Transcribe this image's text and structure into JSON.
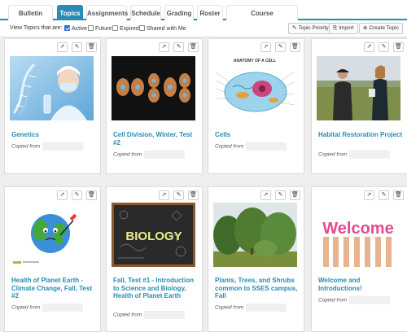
{
  "tabs": [
    {
      "label": "Bulletin board",
      "active": false
    },
    {
      "label": "Topics",
      "active": true
    },
    {
      "label": "Assignments",
      "active": false
    },
    {
      "label": "Schedule",
      "active": false
    },
    {
      "label": "Grading",
      "active": false
    },
    {
      "label": "Roster",
      "active": false
    },
    {
      "label": "Course recommendations",
      "active": false
    }
  ],
  "filter": {
    "label": "View Topics that are:",
    "options": [
      {
        "label": "Active",
        "checked": true
      },
      {
        "label": "Future",
        "checked": false
      },
      {
        "label": "Expired",
        "checked": false
      },
      {
        "label": "Shared with Me",
        "checked": false
      }
    ]
  },
  "toolbar": {
    "topic_priority": "Topic Priority",
    "import": "Import",
    "create_topic": "Create Topic"
  },
  "cards": [
    {
      "title": "Genetics",
      "copied_label": "Copied from",
      "image": "dna-scientist"
    },
    {
      "title": "Cell Division, Winter, Test #2",
      "copied_label": "Copied from",
      "image": "cell-division"
    },
    {
      "title": "Cells",
      "copied_label": "Copied from",
      "image": "anatomy-of-a-cell"
    },
    {
      "title": "Habitat Restoration Project",
      "copied_label": "Copied from",
      "image": "field-people"
    },
    {
      "title": "Health of Planet Earth - Climate Change, Fall, Test #2",
      "copied_label": "Copied from",
      "image": "sick-earth"
    },
    {
      "title": "Fall, Test #1 - Introduction to Science and Biology, Health of Planet Earth",
      "copied_label": "Copied from",
      "image": "biology-chalkboard"
    },
    {
      "title": "Plants, Trees, and Shrubs common to SSES campus, Fall",
      "copied_label": "Copied from",
      "image": "trees"
    },
    {
      "title": "Welcome and Introductions!",
      "copied_label": "Copied from",
      "image": "welcome-hands"
    }
  ],
  "image_text": {
    "cell_heading": "ANATOMY OF A CELL",
    "biology": "BIOLOGY",
    "welcome": "Welcome"
  },
  "colors": {
    "accent": "#2a8bb3",
    "checkbox": "#2c6fd6"
  }
}
